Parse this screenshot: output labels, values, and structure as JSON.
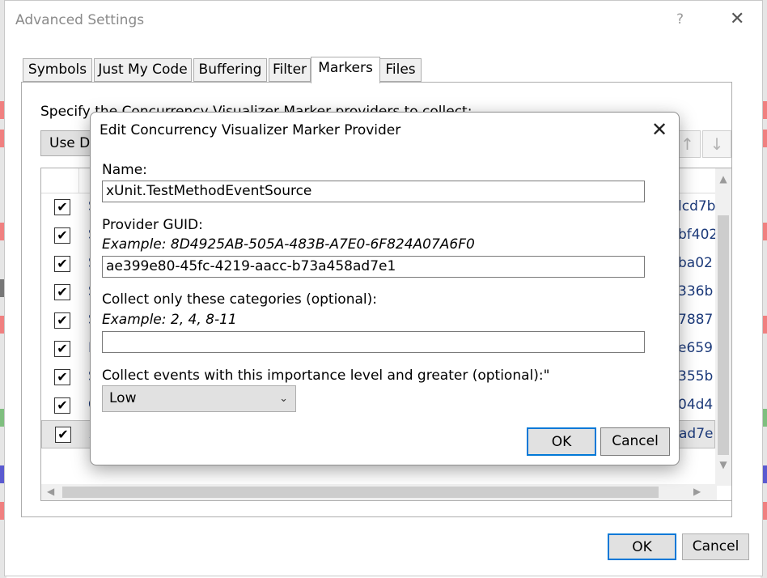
{
  "window": {
    "title": "Advanced Settings",
    "help_glyph": "?",
    "close_glyph": "✕"
  },
  "tabs": [
    {
      "label": "Symbols"
    },
    {
      "label": "Just My Code"
    },
    {
      "label": "Buffering"
    },
    {
      "label": "Filter"
    },
    {
      "label": "Markers",
      "active": true
    },
    {
      "label": "Files"
    }
  ],
  "markers_panel": {
    "instruction": "Specify the Concurrency Visualizer Marker providers to collect:",
    "use_default_label": "Use De",
    "move_down_glyph": "↓",
    "move_up_glyph": "↑",
    "rows": [
      {
        "checked": true,
        "name": "S",
        "guid": "lcd7b"
      },
      {
        "checked": true,
        "name": "S",
        "guid": "bf402"
      },
      {
        "checked": true,
        "name": "S",
        "guid": "ba02"
      },
      {
        "checked": true,
        "name": "S",
        "guid": "336b"
      },
      {
        "checked": true,
        "name": "S",
        "guid": "7887"
      },
      {
        "checked": true,
        "name": "F",
        "guid": "e659"
      },
      {
        "checked": true,
        "name": "S",
        "guid": "355b"
      },
      {
        "checked": true,
        "name": "C",
        "guid": "04d4"
      },
      {
        "checked": true,
        "name": "x",
        "guid": "ad7e",
        "selected": true
      }
    ],
    "check_glyph": "✔"
  },
  "footer": {
    "ok_label": "OK",
    "cancel_label": "Cancel"
  },
  "dialog": {
    "title": "Edit Concurrency Visualizer Marker Provider",
    "close_glyph": "✕",
    "name_label": "Name:",
    "name_value": "xUnit.TestMethodEventSource",
    "guid_label": "Provider GUID:",
    "guid_hint": "Example: 8D4925AB-505A-483B-A7E0-6F824A07A6F0",
    "guid_value": "ae399e80-45fc-4219-aacc-b73a458ad7e1",
    "categories_label": "Collect only these categories (optional):",
    "categories_hint": "Example: 2, 4, 8-11",
    "categories_value": "",
    "importance_label": "Collect events with this importance level and greater (optional):\"",
    "importance_value": "Low",
    "ok_label": "OK",
    "cancel_label": "Cancel"
  },
  "colors": {
    "accent": "#0078d7",
    "link_text": "#1c3a7a"
  }
}
